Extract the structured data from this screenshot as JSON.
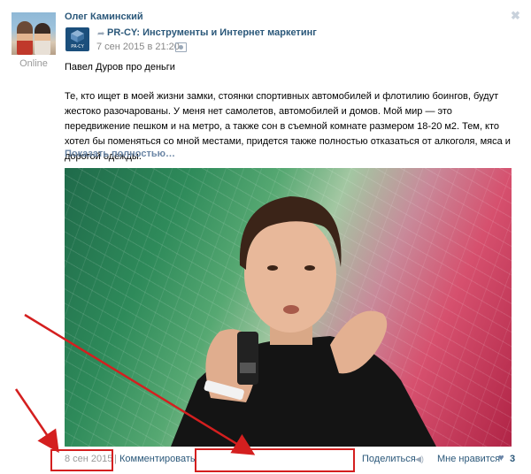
{
  "author": {
    "name": "Олег Каминский",
    "status": "Online"
  },
  "repost": {
    "group_name": "PR-CY: Инструменты и Интернет маркетинг",
    "date_prefix": "7 сен 2015 в ",
    "date_time": "21:20",
    "logo_caption": "PR-CY"
  },
  "post": {
    "title": "Павел Дуров про деньги",
    "text": "Те, кто ищет в моей жизни замки, стоянки спортивных автомобилей и флотилию боингов, будут жестоко разочарованы. У меня нет самолетов, автомобилей и домов. Мой мир — это передвижение пешком и на метро, а также сон в съемной комнате размером 18-20 м2. Тем, кто хотел бы поменяться со мной местами, придется также полностью отказаться от алкоголя, мяса и дорогой одежды.",
    "show_more": "Показать полностью…"
  },
  "footer": {
    "date": "8 сен 2015",
    "separator": "|",
    "comment": "Комментировать",
    "share": "Поделиться",
    "like": "Мне нравится",
    "like_count": "3"
  },
  "icons": {
    "close": "close-icon",
    "share": "megaphone-icon",
    "like": "heart-icon",
    "photo": "camera-icon"
  },
  "colors": {
    "link": "#2b587a",
    "muted": "#999999",
    "annotation": "#d41f1f"
  }
}
